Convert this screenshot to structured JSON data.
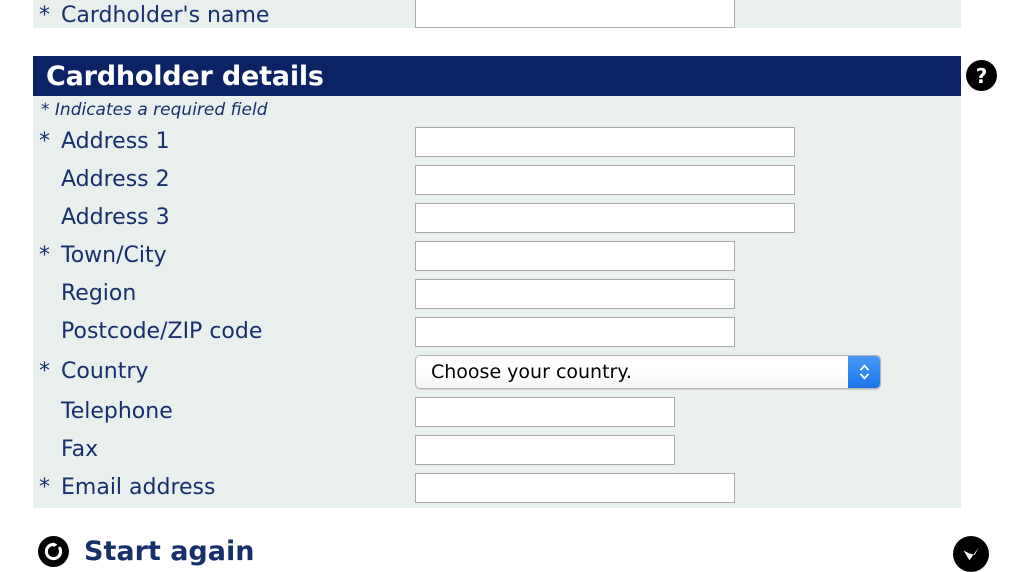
{
  "top_panel": {
    "row": {
      "required": true,
      "star": "*",
      "label": "Cardholder's name",
      "value": "",
      "placeholder": ""
    }
  },
  "section": {
    "title": "Cardholder details",
    "required_note": "* Indicates a required field",
    "help_icon": "help-question-icon",
    "help_glyph": "?",
    "rows": [
      {
        "star": "*",
        "required": true,
        "label": "Address 1",
        "value": "",
        "placeholder": "",
        "width": "w380",
        "type": "text"
      },
      {
        "star": "*",
        "required": false,
        "label": "Address 2",
        "value": "",
        "placeholder": "",
        "width": "w380",
        "type": "text"
      },
      {
        "star": "*",
        "required": false,
        "label": "Address 3",
        "value": "",
        "placeholder": "",
        "width": "w380",
        "type": "text"
      },
      {
        "star": "*",
        "required": true,
        "label": "Town/City",
        "value": "",
        "placeholder": "",
        "width": "w320",
        "type": "text"
      },
      {
        "star": "*",
        "required": false,
        "label": "Region",
        "value": "",
        "placeholder": "",
        "width": "w320",
        "type": "text"
      },
      {
        "star": "*",
        "required": false,
        "label": "Postcode/ZIP code",
        "value": "",
        "placeholder": "",
        "width": "w320",
        "type": "text"
      },
      {
        "star": "*",
        "required": true,
        "label": "Country",
        "value": "Choose your country.",
        "placeholder": "",
        "width": "select",
        "type": "select"
      },
      {
        "star": "*",
        "required": false,
        "label": "Telephone",
        "value": "",
        "placeholder": "",
        "width": "w260",
        "type": "text"
      },
      {
        "star": "*",
        "required": false,
        "label": "Fax",
        "value": "",
        "placeholder": "",
        "width": "w260",
        "type": "text"
      },
      {
        "star": "*",
        "required": true,
        "label": "Email address",
        "value": "",
        "placeholder": "",
        "width": "w320",
        "type": "text"
      }
    ]
  },
  "country_select": {
    "selected": "Choose your country.",
    "stepper_icon": "up-down-chevron-icon"
  },
  "footer": {
    "start_again_label": "Start again",
    "start_again_icon": "reset-circle-icon",
    "confirm_icon": "check-circle-icon"
  },
  "colors": {
    "header_bar": "#0b2265",
    "panel_background": "#e9efed",
    "text_navy": "#17306b",
    "field_border": "#a9a9a9",
    "stepper_blue": "#1874e8",
    "page_background": "#ffffff"
  }
}
